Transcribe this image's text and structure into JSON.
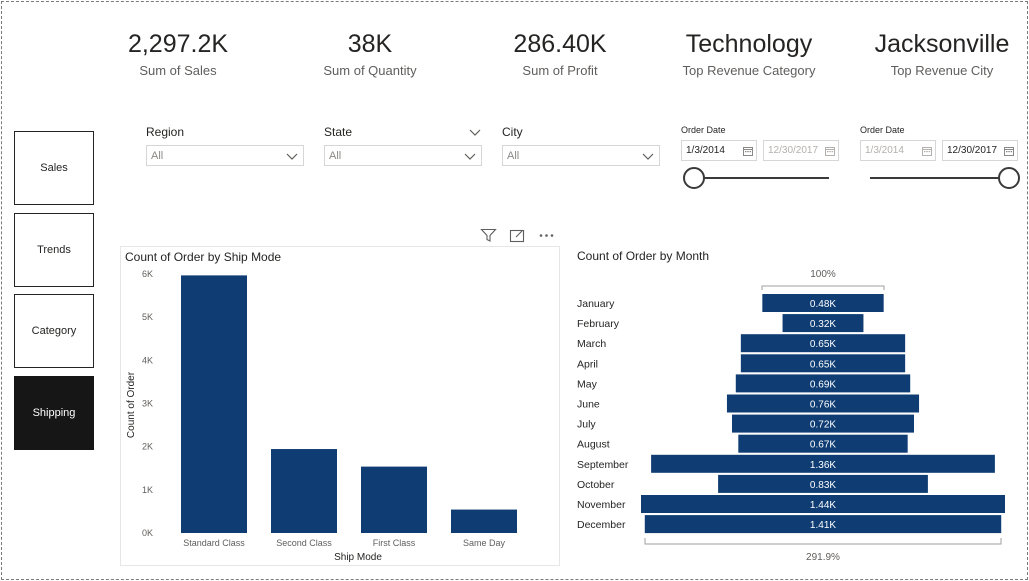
{
  "kpis": [
    {
      "value": "2,297.2K",
      "label": "Sum of Sales"
    },
    {
      "value": "38K",
      "label": "Sum of Quantity"
    },
    {
      "value": "286.40K",
      "label": "Sum of Profit"
    },
    {
      "value": "Technology",
      "label": "Top Revenue Category"
    },
    {
      "value": "Jacksonville",
      "label": "Top Revenue City"
    }
  ],
  "nav": {
    "sales": "Sales",
    "trends": "Trends",
    "category": "Category",
    "shipping": "Shipping"
  },
  "slicers": {
    "region": {
      "title": "Region",
      "value": "All"
    },
    "state": {
      "title": "State",
      "value": "All"
    },
    "city": {
      "title": "City",
      "value": "All"
    }
  },
  "date_slicer_1": {
    "title": "Order Date",
    "start": "1/3/2014",
    "end": "12/30/2017"
  },
  "date_slicer_2": {
    "title": "Order Date",
    "start": "1/3/2014",
    "end": "12/30/2017"
  },
  "icons": {
    "filter": "filter-icon",
    "focus": "focus-mode-icon",
    "more": "more-options-icon"
  },
  "colors": {
    "bar": "#0f3d73",
    "nav_active": "#161616"
  },
  "chart_data": [
    {
      "type": "bar",
      "title": "Count of Order by Ship Mode",
      "xlabel": "Ship Mode",
      "ylabel": "Count of Order",
      "categories": [
        "Standard Class",
        "Second Class",
        "First Class",
        "Same Day"
      ],
      "values": [
        5968,
        1945,
        1538,
        543
      ],
      "yticks": [
        "0K",
        "1K",
        "2K",
        "3K",
        "4K",
        "5K",
        "6K"
      ],
      "ylim": [
        0,
        6000
      ],
      "grid": false
    },
    {
      "type": "bar",
      "title": "Count of Order by Month",
      "categories": [
        "January",
        "February",
        "March",
        "April",
        "May",
        "June",
        "July",
        "August",
        "September",
        "October",
        "November",
        "December"
      ],
      "values": [
        480,
        320,
        650,
        650,
        690,
        760,
        720,
        670,
        1360,
        830,
        1440,
        1410
      ],
      "labels": [
        "0.48K",
        "0.32K",
        "0.65K",
        "0.65K",
        "0.69K",
        "0.76K",
        "0.72K",
        "0.67K",
        "1.36K",
        "0.83K",
        "1.44K",
        "1.41K"
      ],
      "top_percent": "100%",
      "bottom_percent": "291.9%"
    }
  ]
}
